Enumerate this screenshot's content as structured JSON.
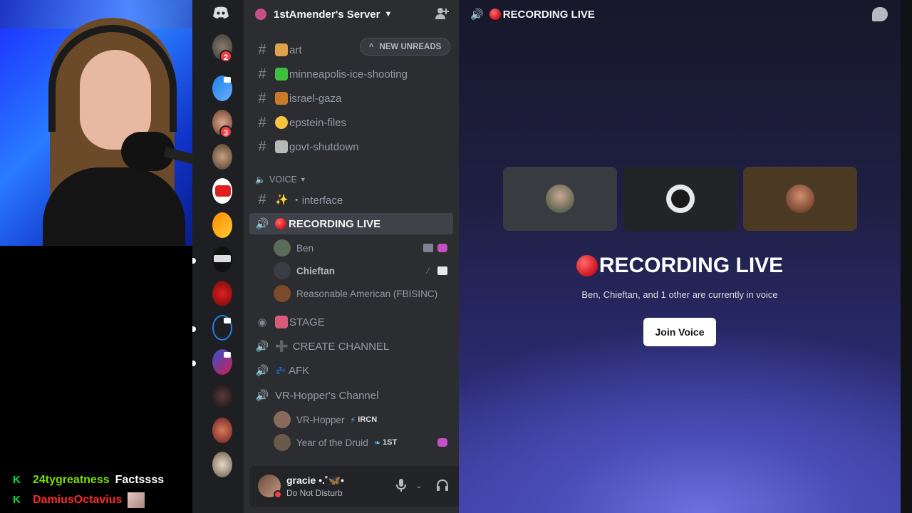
{
  "chat_overlay": {
    "lines": [
      {
        "user": "24tygreatness",
        "message": "Factssss"
      },
      {
        "user": "DamiusOctavius",
        "message": ""
      }
    ]
  },
  "rail": {
    "badges": [
      "2",
      "3"
    ]
  },
  "server": {
    "name": "1stAmender's Server"
  },
  "channels": {
    "new_unreads_label": "NEW UNREADS",
    "text": [
      {
        "name": "art",
        "emoji_color": "#e0a24a"
      },
      {
        "name": "minneapolis-ice-shooting",
        "emoji_color": "#3fbf3f"
      },
      {
        "name": "israel-gaza",
        "emoji_color": "#c97a2a"
      },
      {
        "name": "epstein-files",
        "emoji_color": "#f5c542"
      },
      {
        "name": "govt-shutdown",
        "emoji_color": "#b9b9b9"
      }
    ],
    "voice_category": "VOICE",
    "interface_channel": "・interface",
    "active_voice": "RECORDING LIVE",
    "voice_users": [
      {
        "name": "Ben",
        "avatar_color": "#5b6b5a"
      },
      {
        "name": "Chieftan",
        "avatar_color": "#3a3d45"
      },
      {
        "name": "Reasonable American (FBISINC)",
        "avatar_color": "#7a4a2a"
      }
    ],
    "other_voice": [
      {
        "name": "STAGE",
        "icon": "stage-icon"
      },
      {
        "name": "CREATE CHANNEL",
        "icon": "speaker-icon"
      },
      {
        "name": "AFK",
        "icon": "speaker-icon"
      },
      {
        "name": "VR-Hopper's Channel",
        "icon": "speaker-icon"
      }
    ],
    "hopper_users": [
      {
        "name": "VR-Hopper",
        "tag": "IRCN",
        "avatar_color": "#8a6a5a"
      },
      {
        "name": "Year of the Druid",
        "tag": "1ST",
        "avatar_color": "#6a5a4a"
      }
    ]
  },
  "user_panel": {
    "name": "gracie •.˚🦋•",
    "status": "Do Not Disturb"
  },
  "main": {
    "header_title": "RECORDING LIVE",
    "title": "RECORDING LIVE",
    "subtitle": "Ben, Chieftan, and 1 other are currently in voice",
    "join_label": "Join Voice",
    "tiles": [
      {
        "color": "#3a3b40",
        "avatar_color": "#5b6b5a"
      },
      {
        "color": "#232428",
        "avatar_color": "#e8e8ee"
      },
      {
        "color": "#4a3a24",
        "avatar_color": "#8a4a2a"
      }
    ]
  }
}
